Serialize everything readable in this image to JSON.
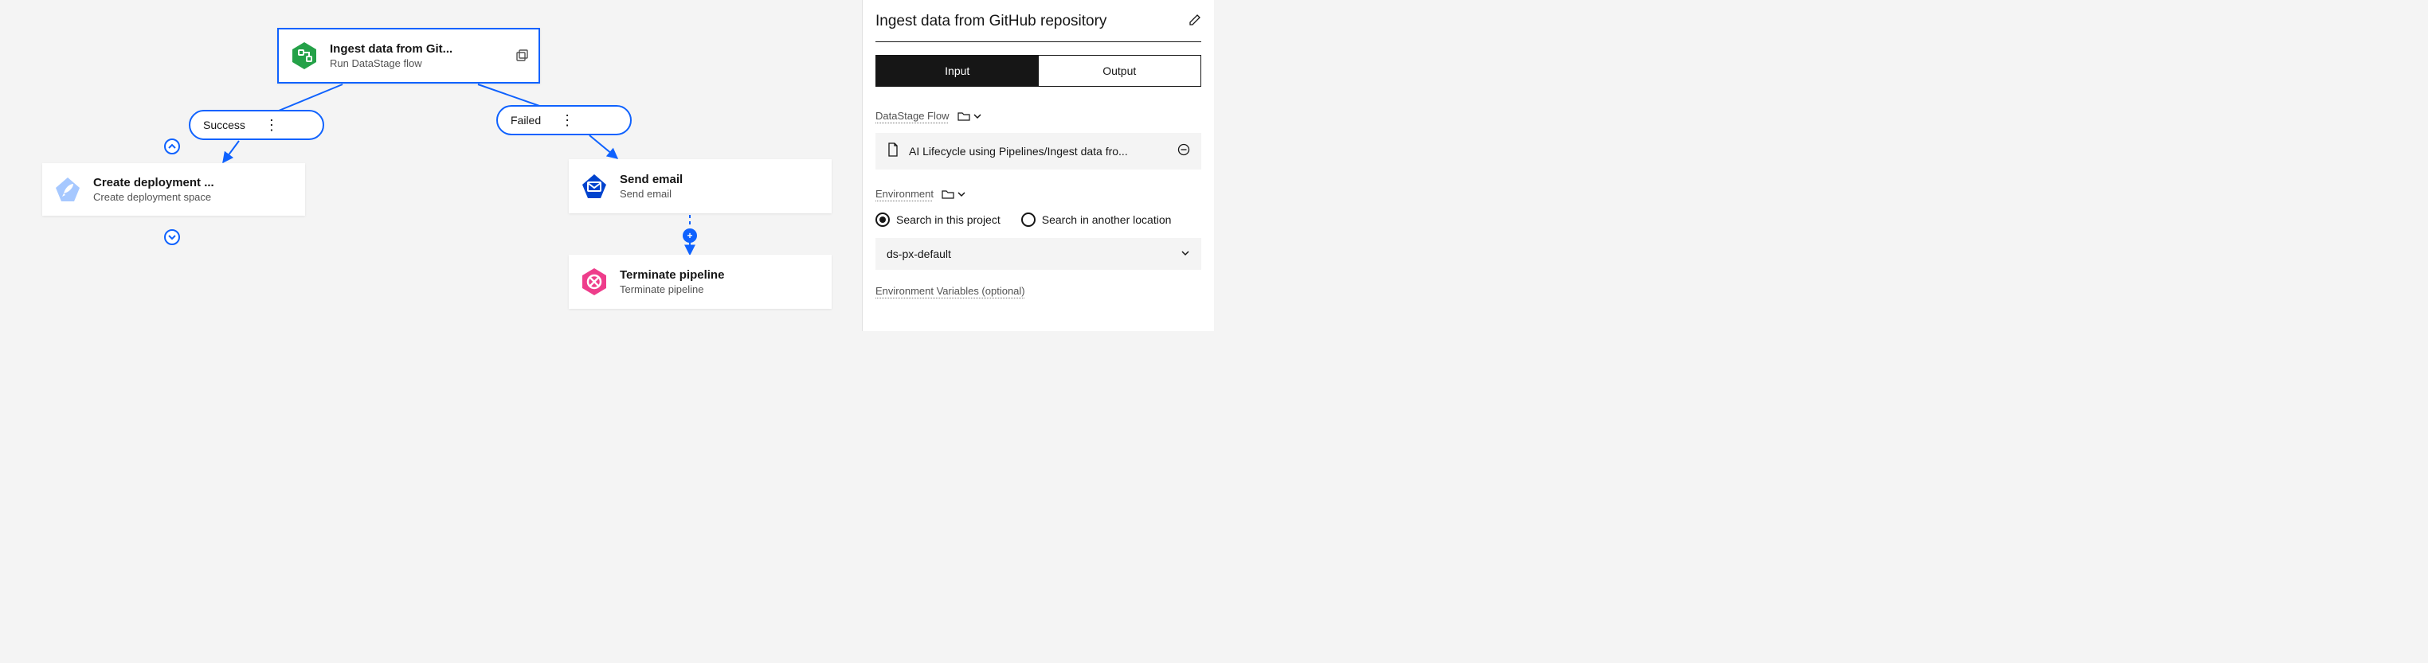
{
  "canvas": {
    "nodes": {
      "ingest": {
        "title": "Ingest data from Git...",
        "subtitle": "Run DataStage flow"
      },
      "deploy": {
        "title": "Create deployment ...",
        "subtitle": "Create deployment space"
      },
      "email": {
        "title": "Send email",
        "subtitle": "Send email"
      },
      "terminate": {
        "title": "Terminate pipeline",
        "subtitle": "Terminate pipeline"
      }
    },
    "branches": {
      "success": {
        "label": "Success"
      },
      "failed": {
        "label": "Failed"
      }
    }
  },
  "panel": {
    "title": "Ingest data from GitHub repository",
    "tabs": {
      "input": "Input",
      "output": "Output",
      "active": "input"
    },
    "datastage_flow": {
      "label": "DataStage Flow",
      "file": "AI Lifecycle using Pipelines/Ingest data fro..."
    },
    "environment": {
      "label": "Environment",
      "search_project": "Search in this project",
      "search_other": "Search in another location",
      "selected_radio": "project",
      "selected_value": "ds-px-default"
    },
    "env_vars": {
      "label": "Environment Variables (optional)"
    }
  }
}
